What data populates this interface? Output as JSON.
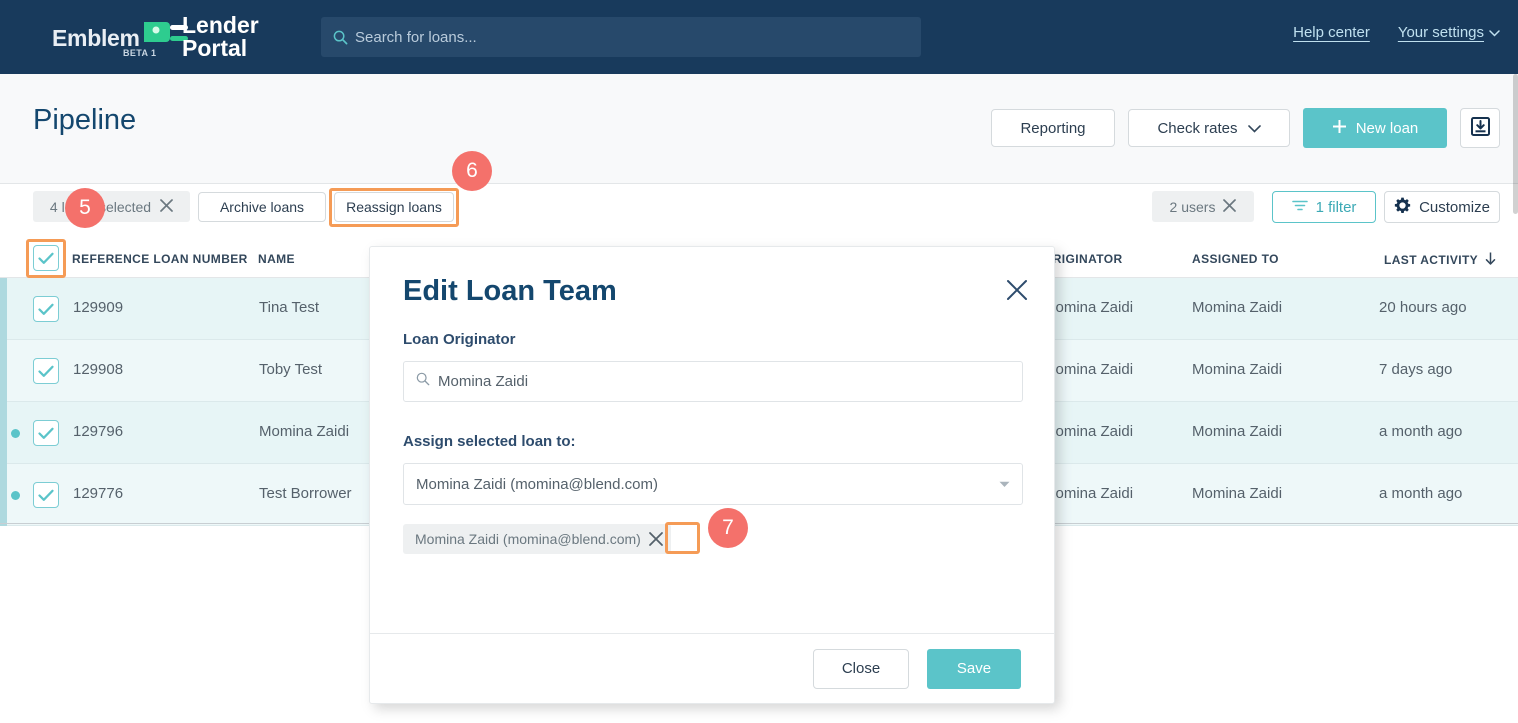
{
  "topnav": {
    "logo": {
      "emblem": "Emblem",
      "beta": "BETA 1",
      "lender": "Lender",
      "portal": "Portal",
      "plug_icon": "plug-icon",
      "plug_color": "#2ecc8f"
    },
    "search": {
      "placeholder": "Search for loans...",
      "value": "",
      "icon": "search-icon"
    },
    "links": [
      {
        "label": "Help center",
        "icon": ""
      },
      {
        "label": "Your settings",
        "icon": "chevron-down-icon"
      }
    ]
  },
  "page": {
    "title": "Pipeline",
    "actions": {
      "reporting": "Reporting",
      "check_rates": "Check rates",
      "check_rates_icon": "chevron-down-icon",
      "new_loan": "New loan",
      "new_loan_icon": "plus-icon",
      "export_icon": "download-box-icon"
    }
  },
  "toolbar": {
    "selected_pill": {
      "label": "4 loans selected",
      "clear_icon": "close-icon"
    },
    "archive_loans": "Archive loans",
    "reassign_loans": "Reassign loans",
    "users_pill": {
      "label": "2 users",
      "clear_icon": "close-icon"
    },
    "filter": {
      "label": "1 filter",
      "icon": "filter-icon"
    },
    "customize": {
      "label": "Customize",
      "icon": "gear-icon"
    }
  },
  "table": {
    "select_all_checked": true,
    "columns": [
      "REFERENCE LOAN NUMBER",
      "NAME",
      "ORIGINATOR",
      "ASSIGNED TO",
      "LAST ACTIVITY"
    ],
    "sort_column": "LAST ACTIVITY",
    "sort_icon": "arrow-down-icon",
    "rows": [
      {
        "checked": true,
        "dot": false,
        "reference": "129909",
        "name": "Tina Test",
        "originator": "Momina Zaidi",
        "assigned_to": "Momina Zaidi",
        "last_activity": "20 hours ago"
      },
      {
        "checked": true,
        "dot": false,
        "reference": "129908",
        "name": "Toby Test",
        "originator": "Momina Zaidi",
        "assigned_to": "Momina Zaidi",
        "last_activity": "7 days ago"
      },
      {
        "checked": true,
        "dot": true,
        "reference": "129796",
        "name": "Momina Zaidi",
        "originator": "Momina Zaidi",
        "assigned_to": "Momina Zaidi",
        "last_activity": "a month ago"
      },
      {
        "checked": true,
        "dot": true,
        "reference": "129776",
        "name": "Test Borrower",
        "originator": "Momina Zaidi",
        "assigned_to": "Momina Zaidi",
        "last_activity": "a month ago"
      }
    ]
  },
  "modal": {
    "title": "Edit Loan Team",
    "close_icon": "close-icon",
    "originator_label": "Loan Originator",
    "originator_value": "Momina Zaidi",
    "originator_icon": "search-icon",
    "assign_label": "Assign selected loan to:",
    "assign_value": "Momina Zaidi (momina@blend.com)",
    "assign_caret_icon": "caret-down-icon",
    "chip": {
      "label": "Momina Zaidi (momina@blend.com)",
      "remove_icon": "close-icon"
    },
    "close_button": "Close",
    "save_button": "Save"
  },
  "annotations": [
    {
      "number": "5",
      "target": "select-all-checkbox"
    },
    {
      "number": "6",
      "target": "reassign-loans-button"
    },
    {
      "number": "7",
      "target": "chip-remove-button"
    }
  ],
  "colors": {
    "navy": "#183a5c",
    "teal": "#5bc4c9",
    "row_selected": "#e7f5f6",
    "annotation_red": "#f4716b",
    "highlight_orange": "#f59b56",
    "title_blue": "#14476e"
  }
}
